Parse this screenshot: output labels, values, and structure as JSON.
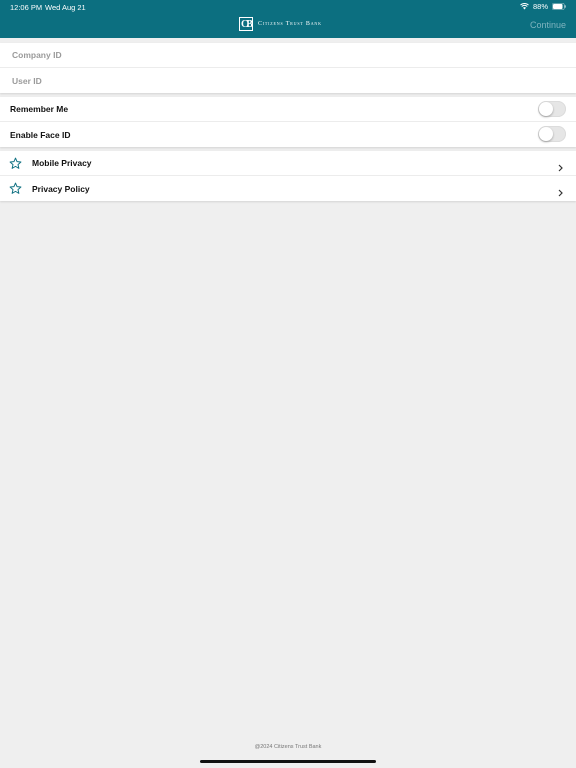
{
  "status_bar": {
    "time": "12:06 PM",
    "date": "Wed Aug 21",
    "battery": "88%",
    "wifi_icon": "wifi-icon",
    "battery_icon": "battery-icon"
  },
  "header": {
    "logo_mark": "CB",
    "logo_text": "Citizens Trust Bank",
    "continue_label": "Continue"
  },
  "login_fields": {
    "company_id_placeholder": "Company ID",
    "company_id_value": "",
    "user_id_placeholder": "User ID",
    "user_id_value": ""
  },
  "settings": {
    "remember_me_label": "Remember Me",
    "remember_me_on": false,
    "face_id_label": "Enable Face ID",
    "face_id_on": false
  },
  "links": [
    {
      "label": "Mobile Privacy",
      "icon": "star-icon"
    },
    {
      "label": "Privacy Policy",
      "icon": "star-icon"
    }
  ],
  "footer": {
    "copyright": "@2024 Citizens Trust Bank"
  },
  "colors": {
    "header_bg": "#0c6f80",
    "continue_disabled": "#7fb4bf",
    "star_stroke": "#0c6f80",
    "background": "#efefef"
  }
}
